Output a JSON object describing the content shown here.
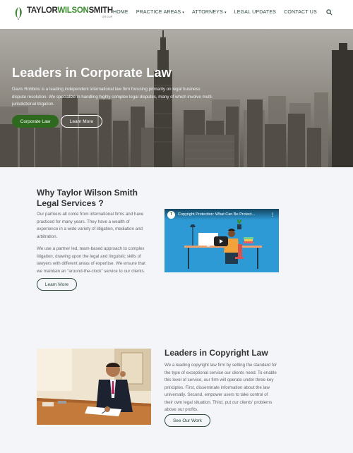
{
  "header": {
    "logo": {
      "name_part1": "TAYLOR",
      "name_part2": "WILSON",
      "name_part3": "SMITH",
      "sub": "GROUP"
    },
    "nav": [
      {
        "label": "HOME",
        "dropdown": false
      },
      {
        "label": "PRACTICE AREAS",
        "dropdown": true
      },
      {
        "label": "ATTORNEYS",
        "dropdown": true
      },
      {
        "label": "LEGAL UPDATES",
        "dropdown": false
      },
      {
        "label": "CONTACT US",
        "dropdown": false
      }
    ],
    "caret": "▾",
    "search_icon": "search-icon"
  },
  "hero": {
    "title": "Leaders in Corporate Law",
    "description": "Davis Robbins is a leading independent international law firm focusing primarily on legal business dispute resolution. We specialize in handling highly complex legal disputes, many of which involve multi-jurisdictional litigation.",
    "primary_button": "Corporate Law",
    "secondary_button": "Learn More"
  },
  "why": {
    "title": "Why Taylor Wilson Smith Legal Services ?",
    "paragraph1": "Our partners all come from international firms and have practiced for many years. They have a wealth of experience in a wide variety of litigation, mediation and arbitration.",
    "paragraph2": "We use a partner led, team-based approach to complex litigation, drawing upon the legal and linguistic skills of lawyers with different areas of expertise. We ensure that we maintain an “around-the-clock” service to our clients.",
    "button": "Learn More"
  },
  "video": {
    "title": "Copyright Protection: What Can Be Protect...",
    "menu": "⋮",
    "channel_initial": "T"
  },
  "copyright": {
    "title": "Leaders in Copyright Law",
    "paragraph": "We a leading copyright law firm by setting the standard for the type of exceptional service our clients need. To enable this level of service, our firm will operate under three key principles. First, disseminate information about the law universally. Second, empower users to take control of their own legal situation. Third, put our clients' problems above our profits.",
    "button": "See Our Work"
  },
  "colors": {
    "brand_green": "#2d6a1e",
    "logo_green": "#3d8c2f",
    "nav_text": "#2e4a3a",
    "section_bg": "#f3f5f8",
    "video_blue": "#2d9ad6"
  }
}
